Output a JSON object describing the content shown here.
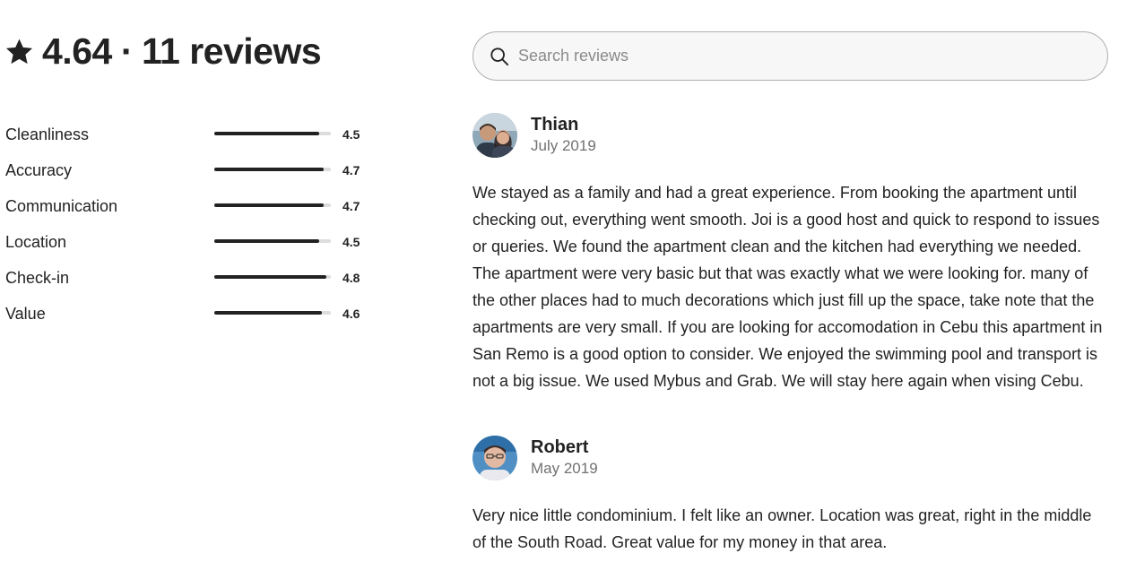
{
  "summary": {
    "icon": "star-icon",
    "rating": "4.64",
    "separator": "·",
    "reviews_count": "11 reviews"
  },
  "ratings": [
    {
      "label": "Cleanliness",
      "value": "4.5",
      "fraction": 0.9
    },
    {
      "label": "Accuracy",
      "value": "4.7",
      "fraction": 0.94
    },
    {
      "label": "Communication",
      "value": "4.7",
      "fraction": 0.94
    },
    {
      "label": "Location",
      "value": "4.5",
      "fraction": 0.9
    },
    {
      "label": "Check-in",
      "value": "4.8",
      "fraction": 0.96
    },
    {
      "label": "Value",
      "value": "4.6",
      "fraction": 0.92
    }
  ],
  "search": {
    "icon": "search-icon",
    "placeholder": "Search reviews",
    "value": ""
  },
  "reviews": [
    {
      "name": "Thian",
      "date": "July 2019",
      "text": "We stayed as a family and had a great experience. From booking the apartment until checking out, everything went smooth. Joi is a good host and quick to respond to issues or queries. We found the apartment clean and the kitchen had everything we needed. The apartment were very basic but that was exactly what we were looking for. many of the other places had to much decorations which just fill up the space, take note that the apartments are very small. If you are looking for accomodation in Cebu this apartment in San Remo is a good option to consider. We enjoyed the swimming pool and transport is not a big issue. We used Mybus and Grab. We will stay here again when vising Cebu."
    },
    {
      "name": "Robert",
      "date": "May 2019",
      "text": "Very nice little condominium. I felt like an owner. Location was great, right in the middle of the South Road. Great value for my money in that area."
    }
  ],
  "colors": {
    "text": "#222222",
    "muted": "#717171",
    "bar_track": "#dddddd",
    "bar_fill": "#222222",
    "search_border": "#b0b0b0"
  }
}
